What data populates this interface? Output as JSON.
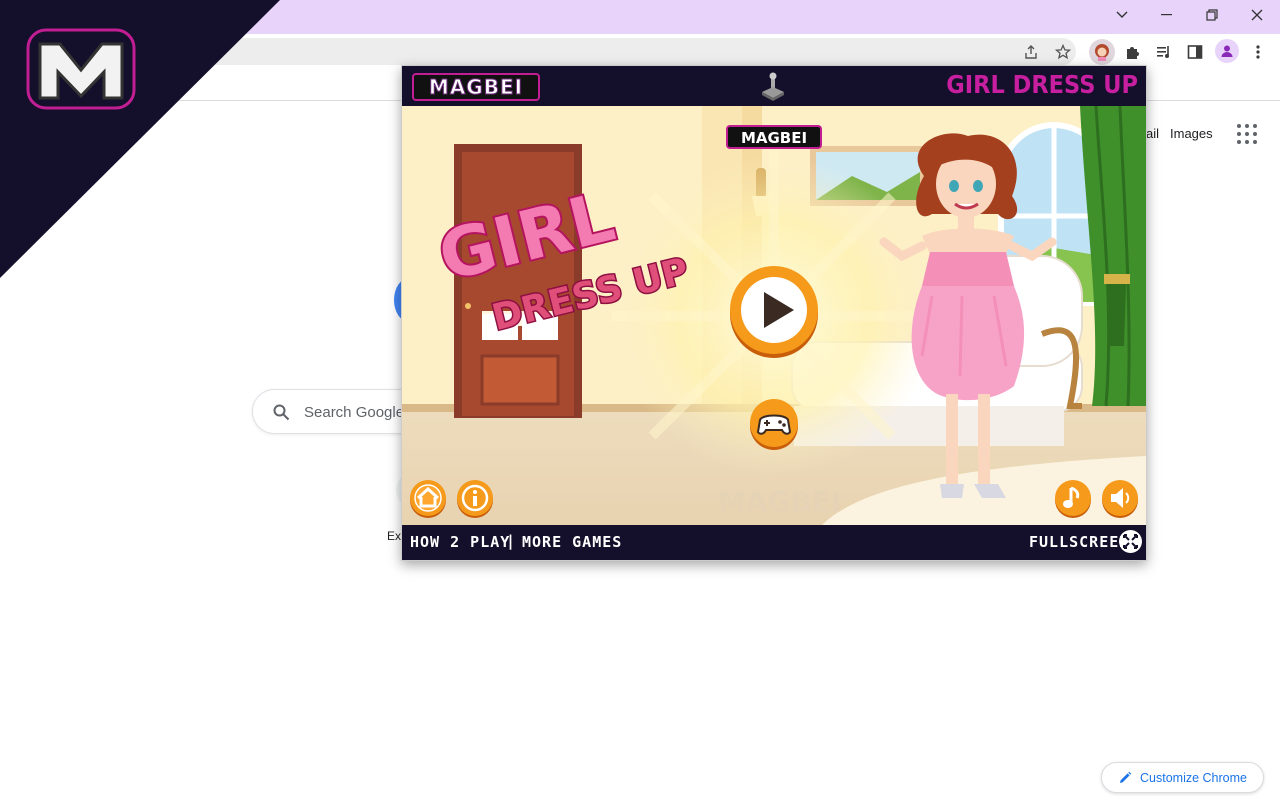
{
  "browser": {
    "window_controls": [
      "chevron-down",
      "minimize",
      "restore",
      "close"
    ],
    "toolbar_icons": [
      "share-icon",
      "star-icon",
      "extension-avatar-icon",
      "puzzle-icon",
      "media-icon",
      "side-panel-icon",
      "profile-icon",
      "kebab-menu-icon"
    ]
  },
  "ntp": {
    "gmail_partial": "ail",
    "images_link": "Images",
    "search_placeholder": "Search Google",
    "shortcut_label_partial": "Ex",
    "customize_label": "Customize Chrome"
  },
  "corner_logo": {
    "letter": "M"
  },
  "popup": {
    "brand": "MAGBEI",
    "title": "GIRL DRESS UP",
    "in_game_brand": "MAGBEI",
    "game_logo_line1": "GIRL",
    "game_logo_line2": "DRESS UP",
    "watermark": "MAGBEI",
    "footer": {
      "how_to_play": "HOW 2 PLAY",
      "separator": "|",
      "more_games": "MORE GAMES",
      "fullscreen": "FULLSCREEN"
    }
  },
  "colors": {
    "titlebar": "#e8d4fb",
    "popup_bg": "#14102b",
    "accent_pink": "#c71fa0",
    "orange_button": "#f08a14",
    "link_blue": "#1a73e8"
  }
}
